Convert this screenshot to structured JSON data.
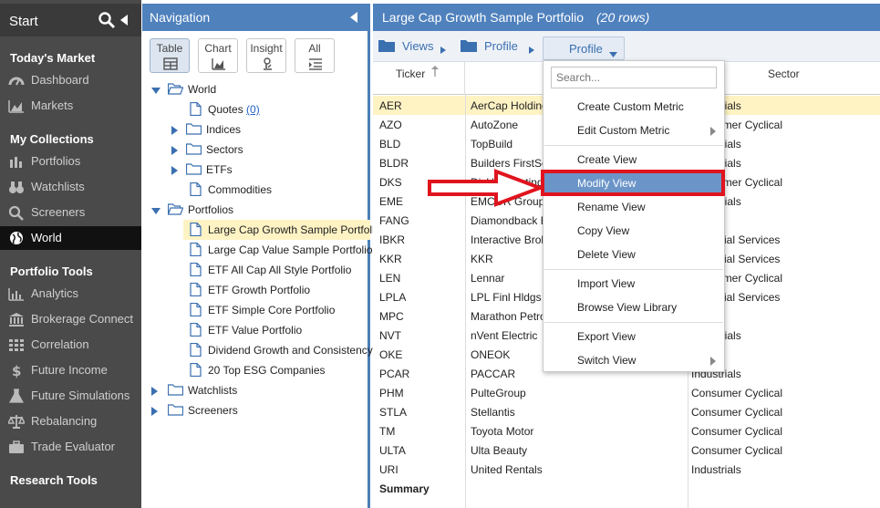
{
  "sidebar": {
    "start_label": "Start",
    "sections": [
      {
        "title": "Today's Market",
        "items": [
          {
            "label": "Dashboard",
            "icon": "dashboard-icon"
          },
          {
            "label": "Markets",
            "icon": "chart-area-icon"
          }
        ]
      },
      {
        "title": "My Collections",
        "items": [
          {
            "label": "Portfolios",
            "icon": "bar-chart-icon"
          },
          {
            "label": "Watchlists",
            "icon": "binoculars-icon"
          },
          {
            "label": "Screeners",
            "icon": "search-icon"
          },
          {
            "label": "World",
            "icon": "globe-icon",
            "active": true
          }
        ]
      },
      {
        "title": "Portfolio Tools",
        "items": [
          {
            "label": "Analytics",
            "icon": "analytics-icon"
          },
          {
            "label": "Brokerage Connect",
            "icon": "bank-icon"
          },
          {
            "label": "Correlation",
            "icon": "grid-icon"
          },
          {
            "label": "Future Income",
            "icon": "dollar-icon"
          },
          {
            "label": "Future Simulations",
            "icon": "flask-icon"
          },
          {
            "label": "Rebalancing",
            "icon": "scale-icon"
          },
          {
            "label": "Trade Evaluator",
            "icon": "briefcase-icon"
          }
        ]
      },
      {
        "title": "Research Tools",
        "items": []
      }
    ]
  },
  "navigation": {
    "title": "Navigation",
    "tabs": [
      {
        "label": "Table"
      },
      {
        "label": "Chart"
      },
      {
        "label": "Insight"
      },
      {
        "label": "All"
      }
    ],
    "tree": [
      {
        "label": "World",
        "level": 0,
        "type": "folder-open",
        "twisty": "down"
      },
      {
        "label": "Quotes",
        "count": "(0)",
        "level": 1,
        "type": "doc"
      },
      {
        "label": "Indices",
        "level": 1,
        "type": "folder",
        "twisty": "right"
      },
      {
        "label": "Sectors",
        "level": 1,
        "type": "folder",
        "twisty": "right"
      },
      {
        "label": "ETFs",
        "level": 1,
        "type": "folder",
        "twisty": "right"
      },
      {
        "label": "Commodities",
        "level": 1,
        "type": "doc"
      },
      {
        "label": "Portfolios",
        "level": 0,
        "type": "folder-open",
        "twisty": "down"
      },
      {
        "label": "Large Cap Growth Sample Portfolio",
        "level": 1,
        "type": "doc",
        "selected": true
      },
      {
        "label": "Large Cap Value Sample Portfolio",
        "level": 1,
        "type": "doc"
      },
      {
        "label": "ETF All Cap All Style Portfolio",
        "level": 1,
        "type": "doc"
      },
      {
        "label": "ETF Growth Portfolio",
        "level": 1,
        "type": "doc"
      },
      {
        "label": "ETF Simple Core Portfolio",
        "level": 1,
        "type": "doc"
      },
      {
        "label": "ETF Value Portfolio",
        "level": 1,
        "type": "doc"
      },
      {
        "label": "Dividend Growth and Consistency",
        "level": 1,
        "type": "doc"
      },
      {
        "label": "20 Top ESG Companies",
        "level": 1,
        "type": "doc"
      },
      {
        "label": "Watchlists",
        "level": 0,
        "type": "folder",
        "twisty": "right"
      },
      {
        "label": "Screeners",
        "level": 0,
        "type": "folder",
        "twisty": "right"
      }
    ]
  },
  "main": {
    "title": "Large Cap Growth Sample Portfolio",
    "row_count": "(20 rows)",
    "breadcrumbs": [
      {
        "label": "Views"
      },
      {
        "label": "Profile"
      }
    ],
    "profile_button": "Profile",
    "columns": [
      "Ticker",
      "",
      "Sector"
    ],
    "rows": [
      {
        "ticker": "AER",
        "name": "AerCap Holdings",
        "sector": "Industrials",
        "selected": true
      },
      {
        "ticker": "AZO",
        "name": "AutoZone",
        "sector": "Consumer Cyclical"
      },
      {
        "ticker": "BLD",
        "name": "TopBuild",
        "sector": "Industrials"
      },
      {
        "ticker": "BLDR",
        "name": "Builders FirstSource",
        "sector": "Industrials"
      },
      {
        "ticker": "DKS",
        "name": "Dick's Sporting Goods",
        "sector": "Consumer Cyclical"
      },
      {
        "ticker": "EME",
        "name": "EMCOR Group",
        "sector": "Industrials"
      },
      {
        "ticker": "FANG",
        "name": "Diamondback Energy",
        "sector": ""
      },
      {
        "ticker": "IBKR",
        "name": "Interactive Brokers",
        "sector": "Financial Services"
      },
      {
        "ticker": "KKR",
        "name": "KKR",
        "sector": "Financial Services"
      },
      {
        "ticker": "LEN",
        "name": "Lennar",
        "sector": "Consumer Cyclical"
      },
      {
        "ticker": "LPLA",
        "name": "LPL Finl Hldgs",
        "sector": "Financial Services"
      },
      {
        "ticker": "MPC",
        "name": "Marathon Petroleum",
        "sector": ""
      },
      {
        "ticker": "NVT",
        "name": "nVent Electric",
        "sector": "Industrials"
      },
      {
        "ticker": "OKE",
        "name": "ONEOK",
        "sector": ""
      },
      {
        "ticker": "PCAR",
        "name": "PACCAR",
        "sector": "Industrials"
      },
      {
        "ticker": "PHM",
        "name": "PulteGroup",
        "sector": "Consumer Cyclical"
      },
      {
        "ticker": "STLA",
        "name": "Stellantis",
        "sector": "Consumer Cyclical"
      },
      {
        "ticker": "TM",
        "name": "Toyota Motor",
        "sector": "Consumer Cyclical"
      },
      {
        "ticker": "ULTA",
        "name": "Ulta Beauty",
        "sector": "Consumer Cyclical"
      },
      {
        "ticker": "URI",
        "name": "United Rentals",
        "sector": "Industrials"
      }
    ],
    "summary_label": "Summary"
  },
  "menu": {
    "search_placeholder": "Search...",
    "groups": [
      [
        {
          "label": "Create Custom Metric"
        },
        {
          "label": "Edit Custom Metric",
          "submenu": true
        }
      ],
      [
        {
          "label": "Create View"
        },
        {
          "label": "Modify View",
          "highlighted": true
        },
        {
          "label": "Rename View"
        },
        {
          "label": "Copy View"
        },
        {
          "label": "Delete View"
        }
      ],
      [
        {
          "label": "Import View"
        },
        {
          "label": "Browse View Library"
        }
      ],
      [
        {
          "label": "Export View"
        },
        {
          "label": "Switch View",
          "submenu": true
        }
      ]
    ]
  },
  "colors": {
    "header_blue": "#4f81bd",
    "sidebar_bg": "#4a4a4a",
    "selected_row": "#fff3c4",
    "menu_highlight": "#6b95c8",
    "annotation_red": "#e0141e"
  }
}
